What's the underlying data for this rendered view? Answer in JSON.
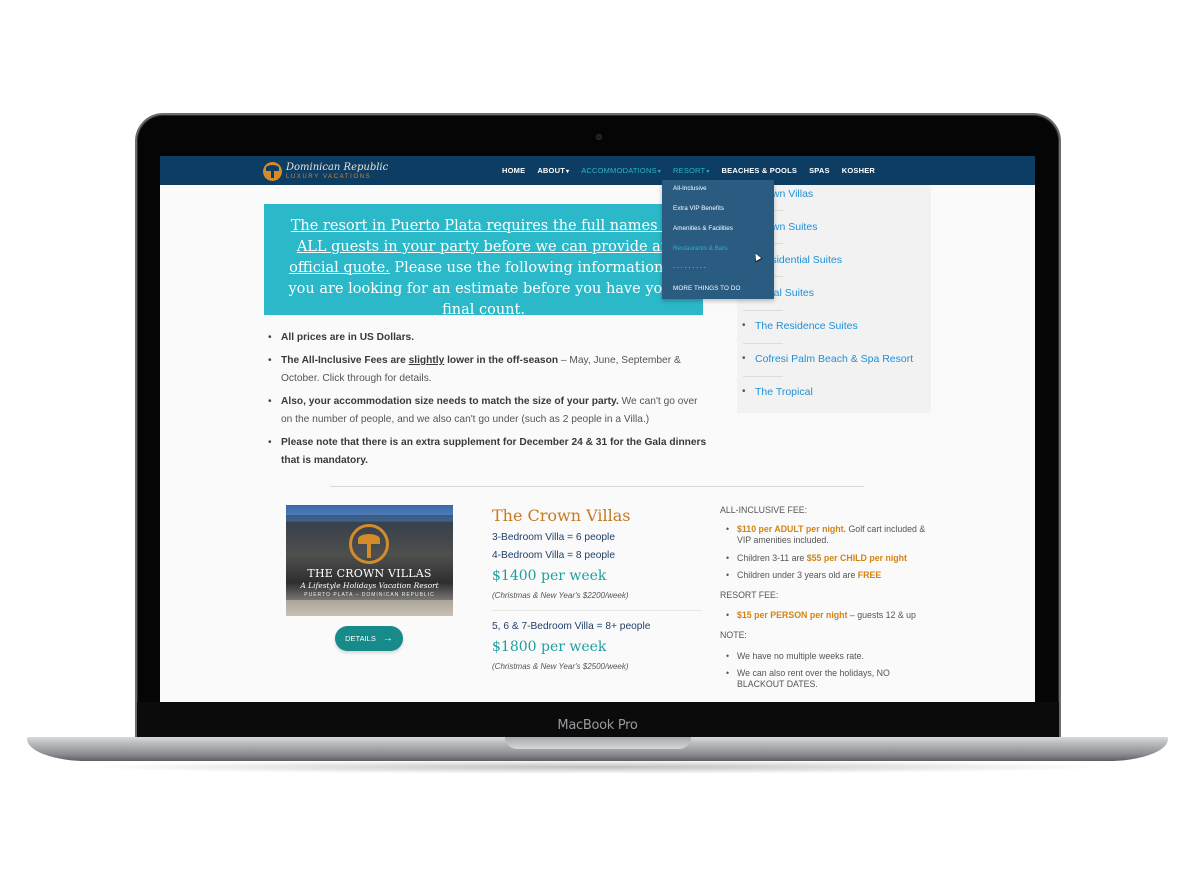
{
  "device": {
    "label": "MacBook Pro"
  },
  "site": {
    "logo": {
      "main": "Dominican Republic",
      "sub": "LUXURY VACATIONS",
      "icon": "palm-tree-icon"
    },
    "colors": {
      "nav_bg": "#0d3d63",
      "accent_teal": "#2bb3c6",
      "callout_bg": "#2bb8c8",
      "link_blue": "#1e90d8",
      "orange": "#c47b23",
      "button_teal": "#178a8a"
    },
    "nav": {
      "items": [
        {
          "label": "HOME",
          "caret": ""
        },
        {
          "label": "ABOUT",
          "caret": "▾"
        },
        {
          "label": "ACCOMMODATIONS",
          "caret": "▾"
        },
        {
          "label": "RESORT",
          "caret": "▾"
        },
        {
          "label": "BEACHES & POOLS",
          "caret": ""
        },
        {
          "label": "SPAS",
          "caret": ""
        },
        {
          "label": "KOSHER",
          "caret": ""
        }
      ]
    },
    "dropdown": {
      "parent": "RESORT",
      "items": [
        {
          "label": "All-Inclusive"
        },
        {
          "label": "Extra VIP Benefits"
        },
        {
          "label": "Amenities & Facilities"
        },
        {
          "label": "Restaurants & Bars"
        },
        {
          "label": "· · · · · · · · ·"
        },
        {
          "label": "MORE THINGS TO DO"
        }
      ],
      "hovered": "Restaurants & Bars"
    },
    "callout": {
      "underlined": "The resort in Puerto Plata requires the full names of ALL guests in your party before we can provide an official quote.",
      "rest": " Please use the following information if you are looking for an estimate before you have your final count."
    },
    "bullets": [
      {
        "bold": "All prices are in US Dollars.",
        "rest": ""
      },
      {
        "bold_before": "The All-Inclusive Fees are ",
        "underlined": "slightly",
        "bold_after": " lower in the off-season",
        "rest": " – May, June, September & October. Click through for details."
      },
      {
        "bold": "Also, your accommodation size needs to match the size of your party.",
        "rest": " We can't go over on the number of people, and we also can't go under (such as 2 people in a Villa.)"
      },
      {
        "bold": "Please note that there is an extra supplement for December 24 & 31 for the Gala dinners that is mandatory.",
        "rest": ""
      }
    ],
    "sidebar": {
      "items": [
        {
          "label": "Crown Villas"
        },
        {
          "label": "Crown Suites"
        },
        {
          "label": "Presidential Suites"
        },
        {
          "label": "Royal Suites"
        },
        {
          "label": "The Residence Suites"
        },
        {
          "label": "Cofresi Palm Beach & Spa Resort"
        },
        {
          "label": "The Tropical"
        }
      ]
    },
    "villa": {
      "image": {
        "title": "THE CROWN VILLAS",
        "tagline": "A Lifestyle Holidays Vacation Resort",
        "location": "PUERTO PLATA – DOMINICAN REPUBLIC"
      },
      "details_button": "DETAILS",
      "title": "The Crown Villas",
      "option1": {
        "configs": [
          "3-Bedroom Villa = 6 people",
          "4-Bedroom Villa = 8 people"
        ],
        "price": "$1400 per week",
        "holiday_note": "(Christmas & New Year's $2200/week)"
      },
      "option2": {
        "configs": [
          "5, 6 & 7-Bedroom Villa = 8+ people"
        ],
        "price": "$1800 per week",
        "holiday_note": "(Christmas & New Year's $2500/week)"
      }
    },
    "fees": {
      "all_inclusive_heading": "ALL-INCLUSIVE FEE:",
      "all_inclusive_items": [
        {
          "before": "",
          "highlight": "$110 per ADULT per night.",
          "after": " Golf cart included & VIP amenities included."
        },
        {
          "before": "Children 3-11 are ",
          "highlight": "$55 per CHILD per night",
          "after": ""
        },
        {
          "before": "Children under 3 years old are ",
          "highlight": "FREE",
          "after": ""
        }
      ],
      "resort_heading": "RESORT FEE:",
      "resort_items": [
        {
          "before": "",
          "highlight": "$15 per PERSON per night",
          "after": " – guests 12 & up"
        }
      ],
      "note_heading": "NOTE:",
      "note_items": [
        {
          "text": "We have no multiple weeks rate."
        },
        {
          "text": "We can also rent over the holidays, NO BLACKOUT DATES."
        }
      ]
    }
  }
}
